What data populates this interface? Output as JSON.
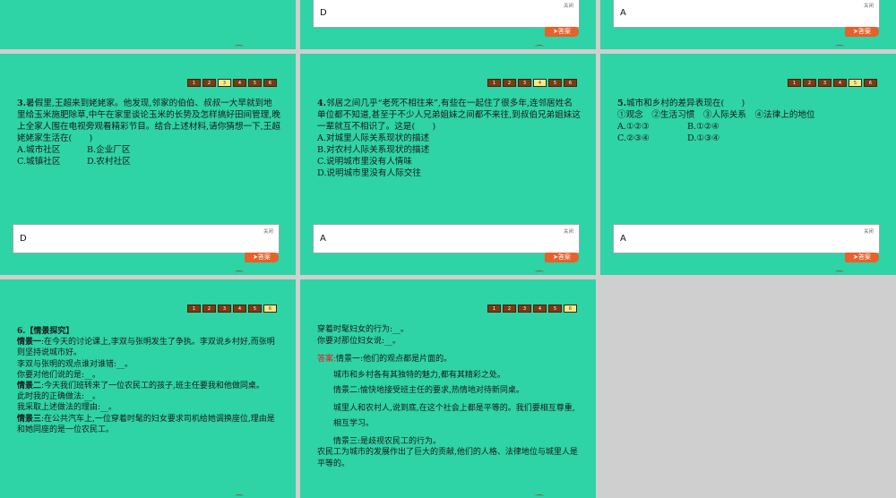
{
  "pager": [
    "1",
    "2",
    "3",
    "4",
    "5",
    "6"
  ],
  "close_label": "关闭",
  "answer_button": "➤答案",
  "top_slides": [
    {
      "answer": "D"
    },
    {
      "answer": "A"
    }
  ],
  "q3": {
    "number": "3.",
    "text": "暑假里,王超来到姥姥家。他发现,邻家的伯伯、叔叔一大早就到地里给玉米施肥除草,中午在家里谈论玉米的长势及怎样搞好田间管理,晚上全家人围在电视旁观看精彩节目。结合上述材料,请你猜想一下,王超姥姥家生活在(　　)",
    "options": [
      "A.城市社区",
      "B.企业厂区",
      "C.城镇社区",
      "D.农村社区"
    ],
    "answer": "D"
  },
  "q4": {
    "number": "4.",
    "text": "邻居之间几乎“老死不相往来”,有些在一起住了很多年,连邻居姓名单位都不知道,甚至于不少人兄弟姐妹之间都不来往,到叔伯兄弟姐妹这一辈就互不相识了。这是(　　)",
    "options": [
      "A.对城里人际关系现状的描述",
      "B.对农村人际关系现状的描述",
      "C.说明城市里没有人情味",
      "D.说明城市里没有人际交往"
    ],
    "answer": "A"
  },
  "q5": {
    "number": "5.",
    "text": "城市和乡村的差异表现在(　　)",
    "items": "①观念　②生活习惯　③人际关系　④法律上的地位",
    "options": [
      "A.①②③",
      "B.①②④",
      "C.②③④",
      "D.①③④"
    ],
    "answer": "A"
  },
  "q6": {
    "number": "6.",
    "title": "【情景探究】",
    "s1_label": "情景一",
    "s1_text": ":在今天的讨论课上,李双与张明发生了争执。李双说乡村好,而张明则坚持说城市好。",
    "s1_q1": "李双与张明的观点谁对谁错:__。",
    "s1_q2": "你要对他们说的是:__。",
    "s2_label": "情景二",
    "s2_text": ":今天我们班转来了一位农民工的孩子,班主任要我和他做同桌。",
    "s2_q1": "此时我的正确做法:__。",
    "s2_q2": "我采取上述做法的理由:__。",
    "s3_label": "情景三",
    "s3_text": ":在公共汽车上,一位穿着时髦的妇女要求司机给她调换座位,理由是和她同座的是一位农民工。"
  },
  "cont": {
    "l1": "穿着时髦妇女的行为:__。",
    "l2": "你要对那位妇女说:__。",
    "ans_label": "答案:",
    "a1": "情景一:他们的观点都是片面的。",
    "a2": "城市和乡村各有其独特的魅力,都有其精彩之处。",
    "a3": "情景二:愉快地接受班主任的要求,热情地对待新同桌。",
    "a4": "城里人和农村人,说到底,在这个社会上都是平等的。我们要相互尊重,相互学习。",
    "a5": "情景三:是歧视农民工的行为。",
    "a6": "农民工为城市的发展作出了巨大的贡献,他们的人格、法律地位与城里人是平等的。"
  }
}
